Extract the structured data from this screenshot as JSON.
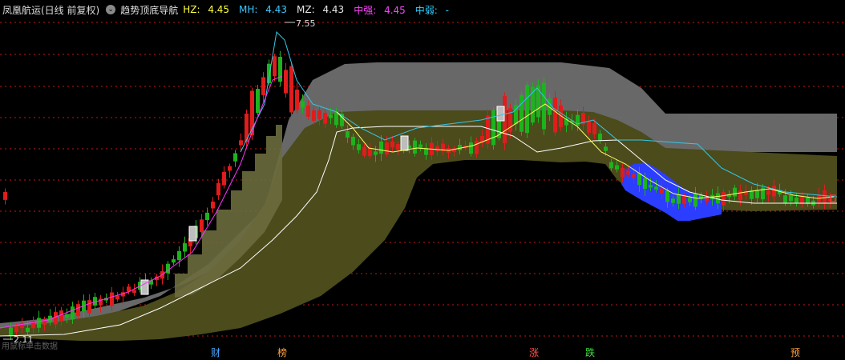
{
  "header": {
    "title": "凤凰航运(日线 前复权)",
    "menu_icon": "chevron-down-icon",
    "indicator": "趋势顶底导航",
    "hz_label": "HZ:",
    "hz_value": "4.45",
    "mh_label": "MH:",
    "mh_value": "4.43",
    "mz_label": "MZ:",
    "mz_value": "4.43",
    "zq_label": "中强:",
    "zq_value": "4.45",
    "zr_label": "中弱:",
    "zr_value": "-"
  },
  "chart": {
    "high_label": "7.55",
    "low_label": "2.11",
    "footer": "用鼠标单击数据",
    "events": [
      {
        "label": "财",
        "color": "#4aa8ff"
      },
      {
        "label": "榜",
        "color": "#ffa040"
      },
      {
        "label": "涨",
        "color": "#ff5050"
      },
      {
        "label": "跌",
        "color": "#40e040"
      },
      {
        "label": "预",
        "color": "#ffa040"
      }
    ]
  },
  "colors": {
    "up": "#e01c1c",
    "down": "#1db31d",
    "band_gray": "#6e6e6e",
    "band_olive": "#4b4b1c",
    "blue_zone": "#2b3dff",
    "ma_white": "#ffffff",
    "ma_cyan": "#35c7e8",
    "ma_magenta": "#ff33ff",
    "ma_yellow": "#ffff66",
    "grid": "#c81414"
  }
}
